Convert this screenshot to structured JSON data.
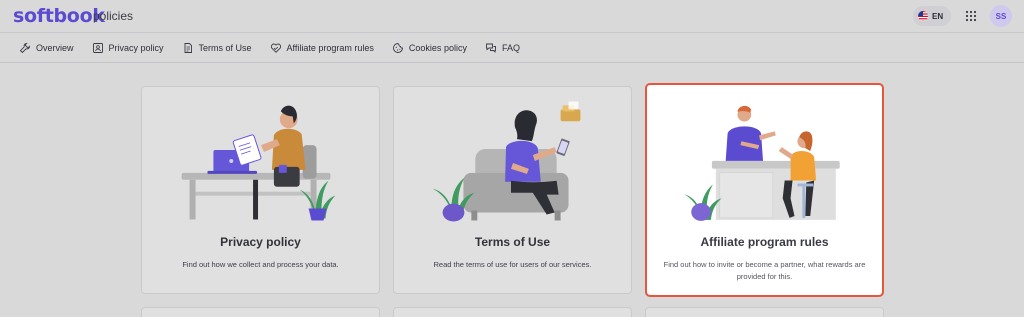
{
  "header": {
    "logo": "softbook",
    "section": "policies",
    "language": "EN",
    "avatar_initials": "SS"
  },
  "nav": {
    "items": [
      {
        "label": "Overview",
        "icon": "wrench-icon"
      },
      {
        "label": "Privacy policy",
        "icon": "id-card-icon"
      },
      {
        "label": "Terms of Use",
        "icon": "document-icon"
      },
      {
        "label": "Affiliate program rules",
        "icon": "heart-handshake-icon"
      },
      {
        "label": "Cookies policy",
        "icon": "cookie-icon"
      },
      {
        "label": "FAQ",
        "icon": "chat-bubbles-icon"
      }
    ]
  },
  "cards": [
    {
      "title": "Privacy policy",
      "description": "Find out how we collect and process your data.",
      "highlighted": false
    },
    {
      "title": "Terms of Use",
      "description": "Read the terms of use for users of our services.",
      "highlighted": false
    },
    {
      "title": "Affiliate program rules",
      "description": "Find out how to invite or become a partner, what rewards are provided for this.",
      "highlighted": true
    }
  ],
  "colors": {
    "brand": "#5b4bd1",
    "highlight_border": "#e8553d",
    "background_overlay": "#d9d9d9"
  }
}
